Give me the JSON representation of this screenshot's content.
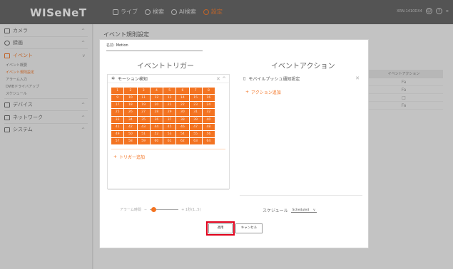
{
  "header": {
    "logo": "WISeNeT",
    "nav": [
      {
        "label": "ライブ",
        "icon": "monitor-icon"
      },
      {
        "label": "検索",
        "icon": "search-icon"
      },
      {
        "label": "AI検索",
        "icon": "ai-search-icon"
      },
      {
        "label": "設定",
        "icon": "settings-icon",
        "active": true
      }
    ],
    "device_id": "XRN-1410DX4",
    "accent_color": "#f37321"
  },
  "sidebar": {
    "items": [
      {
        "label": "カメラ"
      },
      {
        "label": "録画"
      },
      {
        "label": "イベント",
        "active": true
      },
      {
        "label": "デバイス"
      },
      {
        "label": "ネットワーク"
      },
      {
        "label": "システム"
      }
    ],
    "event_subitems": [
      {
        "label": "イベント概要"
      },
      {
        "label": "イベント規則設定",
        "active": true
      },
      {
        "label": "アラーム入力"
      },
      {
        "label": "DWBドライバアップ"
      },
      {
        "label": "スケジュール"
      }
    ]
  },
  "main": {
    "title": "イベント規則設定",
    "bg_table": {
      "header": "イベントアクション",
      "rows": [
        "Fa",
        "Fa",
        "□",
        "Fa"
      ]
    }
  },
  "modal": {
    "name_label": "名前:",
    "name_value": "Motion",
    "trigger_title": "イベントトリガー",
    "action_title": "イベントアクション",
    "trigger_item": "モーション検知",
    "trigger_cells": [
      "1",
      "2",
      "3",
      "4",
      "5",
      "6",
      "7",
      "8",
      "9",
      "10",
      "11",
      "12",
      "13",
      "14",
      "15",
      "16",
      "17",
      "18",
      "19",
      "20",
      "21",
      "22",
      "23",
      "24",
      "25",
      "26",
      "27",
      "28",
      "29",
      "30",
      "31",
      "32",
      "33",
      "34",
      "35",
      "36",
      "37",
      "38",
      "39",
      "40",
      "41",
      "42",
      "43",
      "44",
      "45",
      "46",
      "47",
      "48",
      "49",
      "50",
      "51",
      "52",
      "53",
      "54",
      "55",
      "56",
      "57",
      "58",
      "59",
      "60",
      "61",
      "62",
      "63",
      "64"
    ],
    "add_trigger": "トリガー追加",
    "action_item": "モバイルプッシュ通知設定",
    "add_action": "アクション追加",
    "alarm_label": "アラーム時間",
    "alarm_value": "+ 1秒(1..5)",
    "schedule_label": "スケジュール",
    "schedule_value": "Scheduled",
    "ok_label": "適用",
    "cancel_label": "キャンセル"
  }
}
